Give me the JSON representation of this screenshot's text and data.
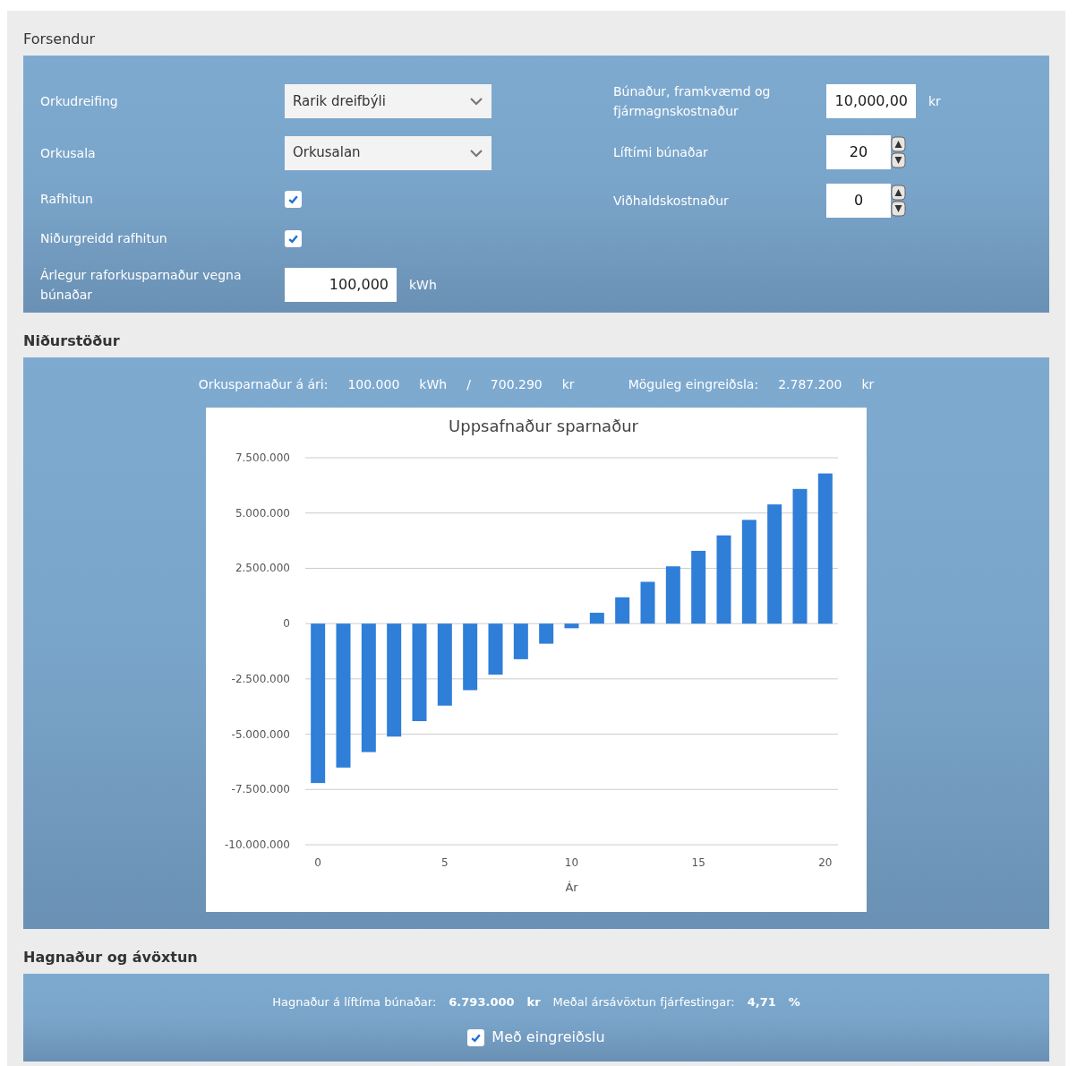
{
  "forsendur": {
    "title": "Forsendur",
    "left": [
      {
        "kind": "select",
        "label": "Orkudreifing",
        "value": "Rarik dreifbýli"
      },
      {
        "kind": "select",
        "label": "Orkusala",
        "value": "Orkusalan"
      },
      {
        "kind": "checkbox",
        "label": "Rafhitun",
        "checked": true
      },
      {
        "kind": "checkbox",
        "label": "Niðurgreidd rafhitun",
        "checked": true
      },
      {
        "kind": "number",
        "label": "Árlegur raforkusparnaður vegna búnaðar",
        "value": "100,000",
        "unit": "kWh"
      }
    ],
    "right": [
      {
        "kind": "number",
        "label": "Búnaður, framkvæmd og fjármagnskostnaður",
        "value": "10,000,00",
        "unit": "kr"
      },
      {
        "kind": "spinner",
        "label": "Líftími búnaðar",
        "value": "20"
      },
      {
        "kind": "spinner",
        "label": "Viðhaldskostnaður",
        "value": "0"
      }
    ]
  },
  "nidurstodur": {
    "title": "Niðurstöður",
    "summary": [
      "Orkusparnaður á ári:",
      "100.000",
      "kWh",
      "/",
      "700.290",
      "kr",
      "Möguleg eingreiðsla:",
      "2.787.200",
      "kr"
    ],
    "chart_data": {
      "type": "bar",
      "title": "Uppsafnaður sparnaður",
      "xlabel": "Ár",
      "x": [
        0,
        1,
        2,
        3,
        4,
        5,
        6,
        7,
        8,
        9,
        10,
        11,
        12,
        13,
        14,
        15,
        16,
        17,
        18,
        19,
        20
      ],
      "series": [
        {
          "color": "#2f7ed8",
          "values": [
            -7210000,
            -6510000,
            -5810000,
            -5110000,
            -4410000,
            -3710000,
            -3010000,
            -2310000,
            -1610000,
            -910000,
            -210000,
            490000,
            1190000,
            1890000,
            2590000,
            3290000,
            3990000,
            4690000,
            5390000,
            6090000,
            6790000
          ]
        }
      ],
      "xlim": [
        -0.5,
        20.5
      ],
      "grid": true,
      "ylim": [
        -10000000,
        7500000
      ],
      "yticks": [
        {
          "value": 7500000,
          "label": "7.500.000"
        },
        {
          "value": 5000000,
          "label": "5.000.000"
        },
        {
          "value": 2500000,
          "label": "2.500.000"
        },
        {
          "value": 0,
          "label": "0"
        },
        {
          "value": -2500000,
          "label": "-2.500.000"
        },
        {
          "value": -5000000,
          "label": "-5.000.000"
        },
        {
          "value": -7500000,
          "label": "-7.500.000"
        },
        {
          "value": -10000000,
          "label": "-10.000.000"
        }
      ],
      "xticks": [
        0,
        5,
        10,
        15,
        20
      ]
    }
  },
  "hagnadur": {
    "title": "Hagnaður og ávöxtun",
    "summary": [
      {
        "text": "Hagnaður á líftíma búnaðar:",
        "bold": false
      },
      {
        "text": "6.793.000",
        "bold": true
      },
      {
        "text": "kr",
        "bold": true
      },
      {
        "text": "Meðal ársávöxtun fjárfestingar:",
        "bold": false
      },
      {
        "text": "4,71",
        "bold": true
      },
      {
        "text": "%",
        "bold": true
      }
    ],
    "option": {
      "label": "Með eingreiðslu",
      "checked": true
    }
  }
}
